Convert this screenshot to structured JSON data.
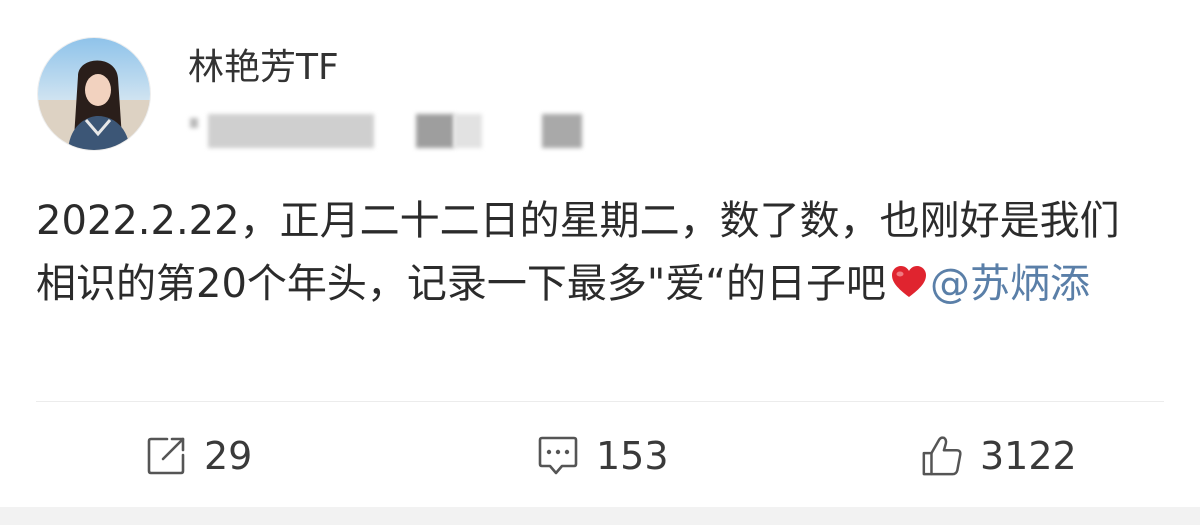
{
  "post": {
    "author": {
      "name": "林艳芳TF",
      "avatar_icon": "user-avatar-photo"
    },
    "text": "2022.2.22，正月二十二日的星期二，数了数，也刚好是我们相识的第20个年头，记录一下最多\"爱“的日子吧",
    "emoji": "red-heart",
    "mention": "@苏炳添",
    "colors": {
      "mention": "#5a7fa8",
      "heart": "#e0242f",
      "text": "#2b2b2b",
      "icon": "#555555"
    }
  },
  "actions": {
    "repost": {
      "icon": "share-icon",
      "count": "29"
    },
    "comment": {
      "icon": "comment-icon",
      "count": "153"
    },
    "like": {
      "icon": "thumbs-up-icon",
      "count": "3122"
    }
  }
}
